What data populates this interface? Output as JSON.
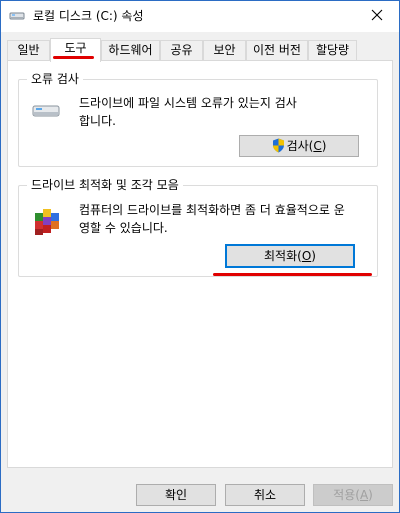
{
  "window": {
    "title": "로컬 디스크 (C:) 속성"
  },
  "tabs": [
    {
      "label": "일반"
    },
    {
      "label": "도구"
    },
    {
      "label": "하드웨어"
    },
    {
      "label": "공유"
    },
    {
      "label": "보안"
    },
    {
      "label": "이전 버전"
    },
    {
      "label": "할당량"
    }
  ],
  "active_tab": "도구",
  "error_check": {
    "title": "오류 검사",
    "description_line1": "드라이브에 파일 시스템 오류가 있는지 검사",
    "description_line2": "합니다.",
    "button_text": "검사",
    "button_mnemonic": "C"
  },
  "optimize": {
    "title": "드라이브 최적화 및 조각 모음",
    "description_line1": "컴퓨터의 드라이브를 최적화하면 좀 더 효율적으로 운",
    "description_line2": "영할 수 있습니다.",
    "button_text": "최적화",
    "button_mnemonic": "O"
  },
  "footer": {
    "ok": "확인",
    "cancel": "취소",
    "apply_text": "적용",
    "apply_mnemonic": "A"
  },
  "colors": {
    "accent": "#0078d7",
    "annotation_red": "#e00000",
    "window_border": "#2b6cc4"
  },
  "icons": {
    "title": "drive-icon",
    "close": "close-icon",
    "error_check": "hard-drive-icon",
    "shield": "uac-shield-icon",
    "optimize": "defrag-icon"
  }
}
